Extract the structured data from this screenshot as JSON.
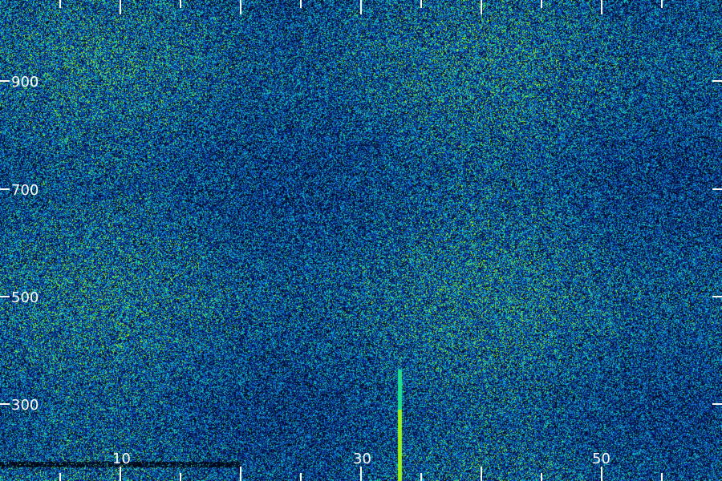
{
  "image": {
    "kind": "waterfall-spectrogram",
    "palette": [
      "#000814",
      "#0a1f6e",
      "#0b3fb0",
      "#0b78c8",
      "#10b8d0",
      "#1fe08a",
      "#9bf21a"
    ]
  },
  "axes": {
    "x_labels": [
      "10",
      "30",
      "50"
    ],
    "y_labels": [
      "900",
      "700",
      "500",
      "300"
    ]
  }
}
